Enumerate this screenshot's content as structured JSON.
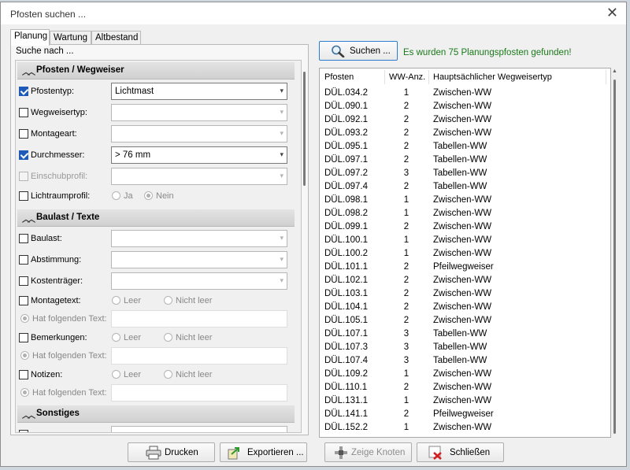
{
  "window": {
    "title": "Pfosten suchen ..."
  },
  "tabs": [
    {
      "label": "Planung",
      "active": true
    },
    {
      "label": "Wartung",
      "active": false
    },
    {
      "label": "Altbestand",
      "active": false
    }
  ],
  "search_group": {
    "legend": "Suche nach ..."
  },
  "sections": {
    "pfosten": "Pfosten / Wegweiser",
    "baulast": "Baulast / Texte",
    "sonstiges": "Sonstiges"
  },
  "fields": {
    "pfostentyp": {
      "label": "Pfostentyp:",
      "checked": true,
      "value": "Lichtmast"
    },
    "wegweisertyp": {
      "label": "Wegweisertyp:",
      "checked": false,
      "value": ""
    },
    "montageart": {
      "label": "Montageart:",
      "checked": false,
      "value": ""
    },
    "durchmesser": {
      "label": "Durchmesser:",
      "checked": true,
      "value": "> 76 mm"
    },
    "einschubprofil": {
      "label": "Einschubprofil:",
      "checked": false,
      "value": ""
    },
    "lichtraumprofil": {
      "label": "Lichtraumprofil:",
      "checked": false,
      "opt_ja": "Ja",
      "opt_nein": "Nein"
    },
    "baulast": {
      "label": "Baulast:",
      "checked": false
    },
    "abstimmung": {
      "label": "Abstimmung:",
      "checked": false
    },
    "kostentraeger": {
      "label": "Kostenträger:",
      "checked": false
    },
    "montagetext": {
      "label": "Montagetext:",
      "checked": false,
      "opt_leer": "Leer",
      "opt_nicht_leer": "Nicht leer",
      "opt_text": "Hat folgenden Text:"
    },
    "bemerkungen": {
      "label": "Bemerkungen:",
      "checked": false,
      "opt_leer": "Leer",
      "opt_nicht_leer": "Nicht leer",
      "opt_text": "Hat folgenden Text:"
    },
    "notizen": {
      "label": "Notizen:",
      "checked": false,
      "opt_leer": "Leer",
      "opt_nicht_leer": "Nicht leer",
      "opt_text": "Hat folgenden Text:"
    }
  },
  "search": {
    "button_label": "Suchen ...",
    "status": "Es wurden 75 Planungspfosten gefunden!"
  },
  "results": {
    "columns": [
      "Pfosten",
      "WW-Anz.",
      "Hauptsächlicher Wegweisertyp"
    ],
    "rows": [
      [
        "DÜL.034.2",
        "1",
        "Zwischen-WW"
      ],
      [
        "DÜL.090.1",
        "2",
        "Zwischen-WW"
      ],
      [
        "DÜL.092.1",
        "2",
        "Zwischen-WW"
      ],
      [
        "DÜL.093.2",
        "2",
        "Zwischen-WW"
      ],
      [
        "DÜL.095.1",
        "2",
        "Tabellen-WW"
      ],
      [
        "DÜL.097.1",
        "2",
        "Tabellen-WW"
      ],
      [
        "DÜL.097.2",
        "3",
        "Tabellen-WW"
      ],
      [
        "DÜL.097.4",
        "2",
        "Tabellen-WW"
      ],
      [
        "DÜL.098.1",
        "1",
        "Zwischen-WW"
      ],
      [
        "DÜL.098.2",
        "1",
        "Zwischen-WW"
      ],
      [
        "DÜL.099.1",
        "2",
        "Zwischen-WW"
      ],
      [
        "DÜL.100.1",
        "1",
        "Zwischen-WW"
      ],
      [
        "DÜL.100.2",
        "1",
        "Zwischen-WW"
      ],
      [
        "DÜL.101.1",
        "2",
        "Pfeilwegweiser"
      ],
      [
        "DÜL.102.1",
        "2",
        "Zwischen-WW"
      ],
      [
        "DÜL.103.1",
        "2",
        "Zwischen-WW"
      ],
      [
        "DÜL.104.1",
        "2",
        "Zwischen-WW"
      ],
      [
        "DÜL.105.1",
        "2",
        "Zwischen-WW"
      ],
      [
        "DÜL.107.1",
        "3",
        "Tabellen-WW"
      ],
      [
        "DÜL.107.3",
        "3",
        "Tabellen-WW"
      ],
      [
        "DÜL.107.4",
        "3",
        "Tabellen-WW"
      ],
      [
        "DÜL.109.2",
        "1",
        "Zwischen-WW"
      ],
      [
        "DÜL.110.1",
        "2",
        "Zwischen-WW"
      ],
      [
        "DÜL.131.1",
        "1",
        "Zwischen-WW"
      ],
      [
        "DÜL.141.1",
        "2",
        "Pfeilwegweiser"
      ],
      [
        "DÜL.152.2",
        "1",
        "Zwischen-WW"
      ]
    ]
  },
  "footer": {
    "print": "Drucken",
    "export": "Exportieren ...",
    "show_nodes": "Zeige Knoten",
    "close": "Schließen"
  },
  "colors": {
    "accent": "#1e5bb8",
    "status": "#1a7a1a"
  },
  "icons": {
    "search": "magnifier-icon",
    "print": "printer-icon",
    "export": "export-icon",
    "nodes": "nodes-icon",
    "close": "close-red-icon"
  }
}
